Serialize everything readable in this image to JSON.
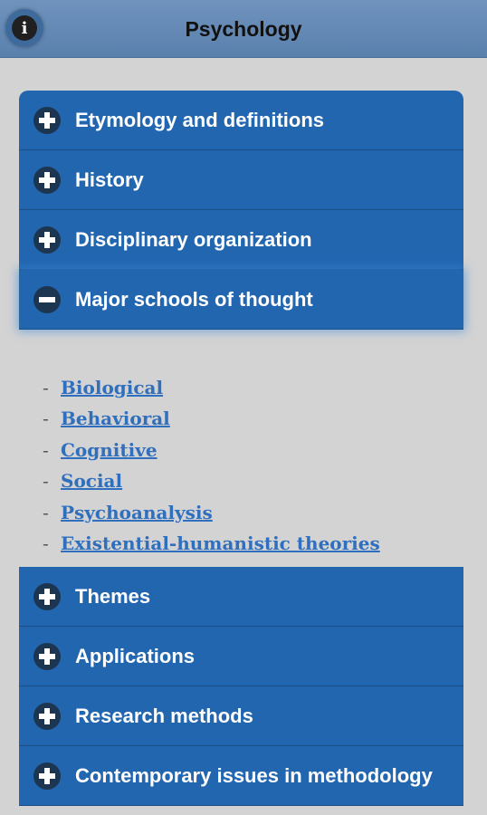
{
  "header": {
    "title": "Psychology",
    "info_icon": "info-icon"
  },
  "sections": [
    {
      "label": "Etymology and definitions",
      "expanded": false
    },
    {
      "label": "History",
      "expanded": false
    },
    {
      "label": "Disciplinary organization",
      "expanded": false
    },
    {
      "label": "Major schools of thought",
      "expanded": true
    },
    {
      "label": "Themes",
      "expanded": false
    },
    {
      "label": "Applications",
      "expanded": false
    },
    {
      "label": "Research methods",
      "expanded": false
    },
    {
      "label": "Contemporary issues in methodology",
      "expanded": false
    }
  ],
  "expanded_links": {
    "bullet": "-",
    "items": [
      "Biological",
      "Behavioral",
      "Cognitive",
      "Social",
      "Psychoanalysis",
      "Existential-humanistic theories"
    ]
  },
  "colors": {
    "header": "#5f86b4",
    "section": "#2266b0",
    "page": "#d3d3d3",
    "link": "#2f6fbd"
  }
}
